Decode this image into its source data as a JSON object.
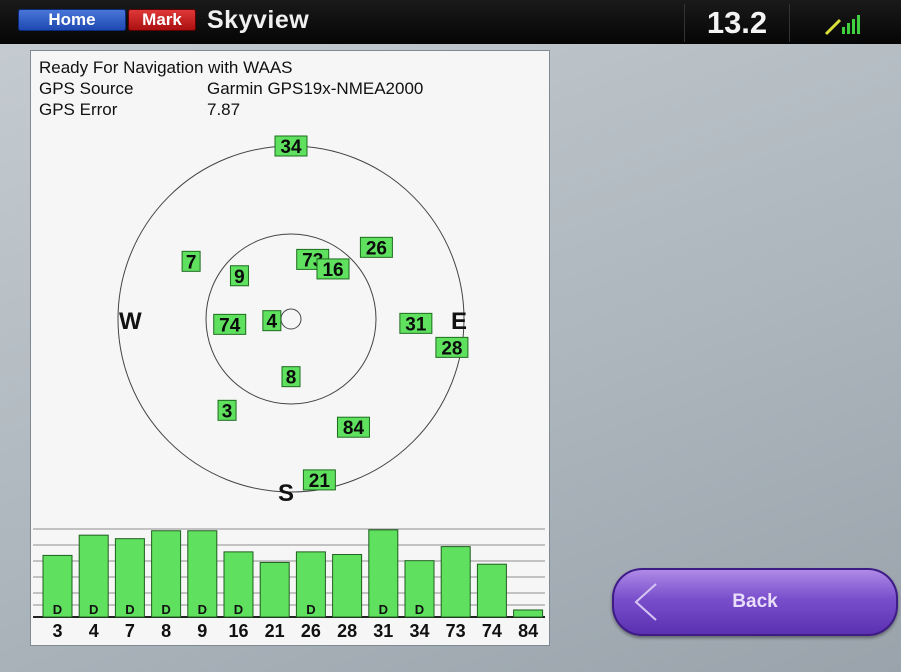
{
  "topbar": {
    "home_label": "Home",
    "mark_label": "Mark",
    "title": "Skyview",
    "readout": "13.2",
    "signal_icon": "signal-strength-icon"
  },
  "info": {
    "status": "Ready For Navigation with WAAS",
    "source_label": "GPS Source",
    "source_value": "Garmin GPS19x-NMEA2000",
    "error_label": "GPS Error",
    "error_value": "7.87"
  },
  "compass": {
    "west": "W",
    "east": "E",
    "south": "S"
  },
  "satellites": [
    {
      "id": "34",
      "az": 0,
      "el": 0
    },
    {
      "id": "7",
      "az": 300,
      "el": 30
    },
    {
      "id": "9",
      "az": 310,
      "el": 55
    },
    {
      "id": "73",
      "az": 20,
      "el": 57
    },
    {
      "id": "16",
      "az": 40,
      "el": 56
    },
    {
      "id": "26",
      "az": 50,
      "el": 32
    },
    {
      "id": "74",
      "az": 265,
      "el": 58
    },
    {
      "id": "4",
      "az": 265,
      "el": 80
    },
    {
      "id": "31",
      "az": 92,
      "el": 25
    },
    {
      "id": "28",
      "az": 100,
      "el": 5
    },
    {
      "id": "8",
      "az": 180,
      "el": 60
    },
    {
      "id": "3",
      "az": 215,
      "el": 32
    },
    {
      "id": "84",
      "az": 150,
      "el": 25
    },
    {
      "id": "21",
      "az": 170,
      "el": 5
    }
  ],
  "chart_data": {
    "type": "bar",
    "categories": [
      "3",
      "4",
      "7",
      "8",
      "9",
      "16",
      "21",
      "26",
      "28",
      "31",
      "34",
      "73",
      "74",
      "84"
    ],
    "values": [
      0.7,
      0.93,
      0.89,
      0.98,
      0.98,
      0.74,
      0.62,
      0.74,
      0.71,
      0.99,
      0.64,
      0.8,
      0.6,
      0.08
    ],
    "flags": [
      "D",
      "D",
      "D",
      "D",
      "D",
      "D",
      "",
      "D",
      "",
      "D",
      "D",
      "",
      "",
      ""
    ],
    "ylim": [
      0,
      1
    ]
  },
  "back_button": {
    "label": "Back",
    "icon": "arrow-left-icon"
  }
}
